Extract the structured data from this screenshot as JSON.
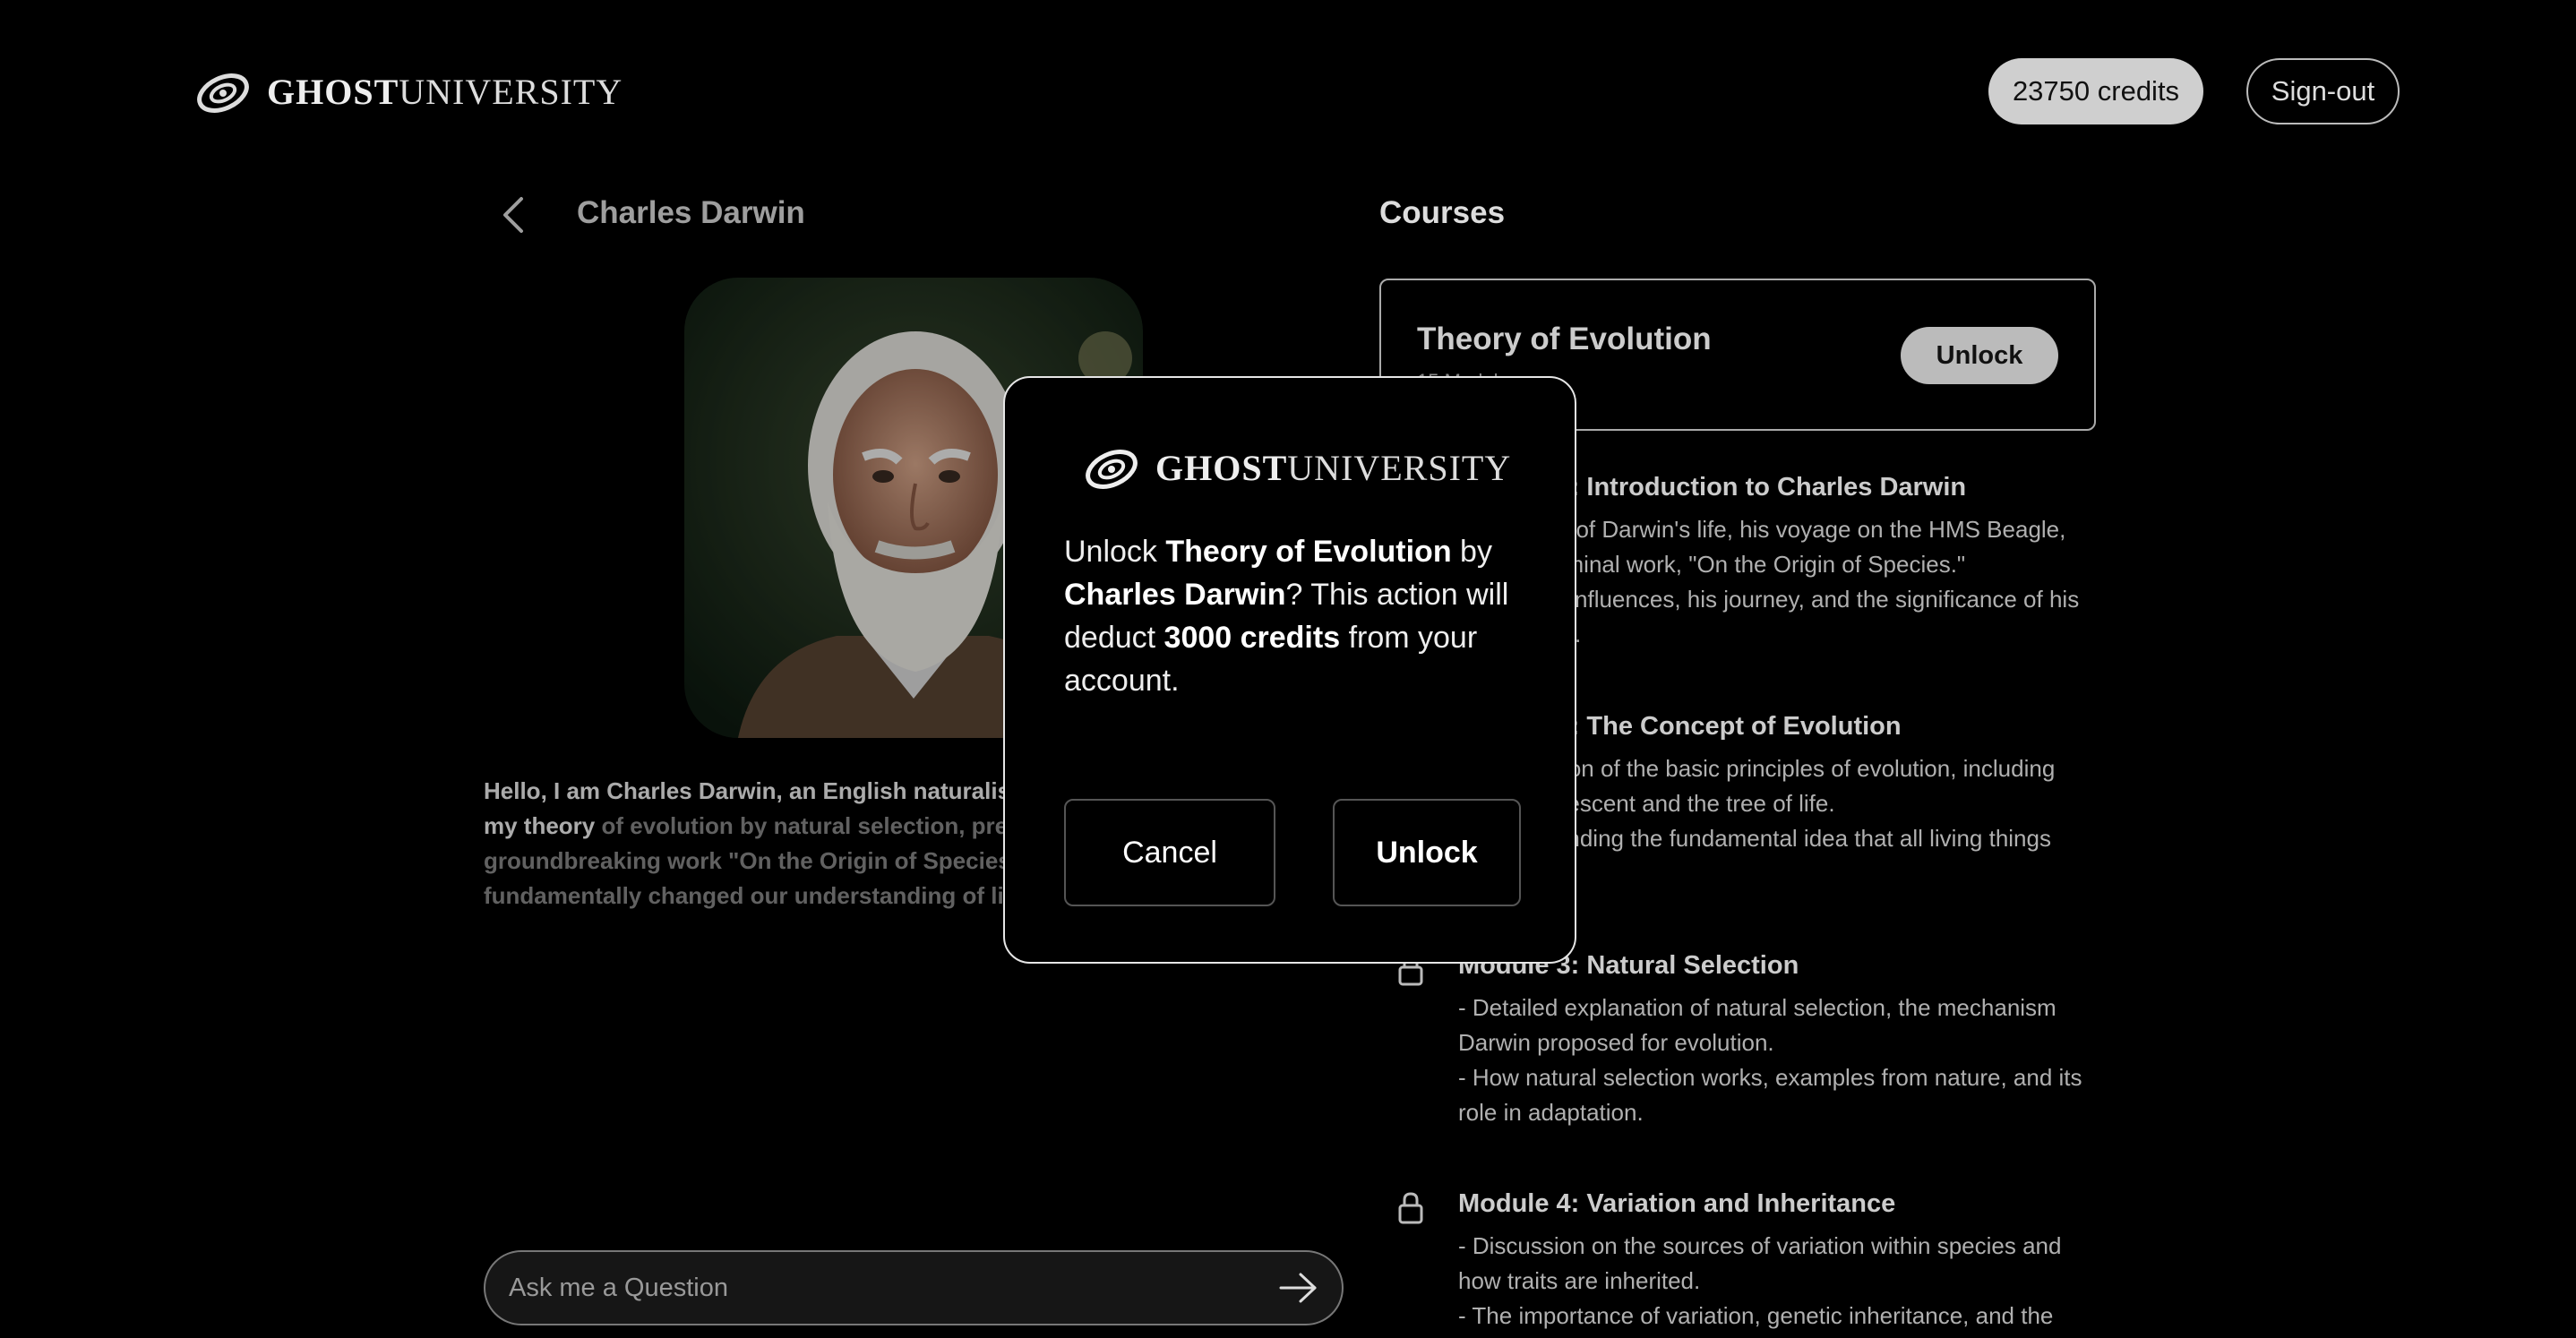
{
  "header": {
    "logo_bold": "GHOST",
    "logo_rest": "UNIVERSITY",
    "credits_label": "23750 credits",
    "signout_label": "Sign-out"
  },
  "profile": {
    "name": "Charles Darwin",
    "bio_bright": "Hello, I am Charles Darwin, an English naturalist. I am best known for my theory",
    "bio_faded": " of evolution by natural selection, presented in my groundbreaking work \"On the Origin of Species.\" My contributions have fundamentally changed our understanding of life on Earth."
  },
  "ask": {
    "placeholder": "Ask me a Question"
  },
  "courses": {
    "title": "Courses",
    "course": {
      "title": "Theory of Evolution",
      "subtitle": "15 Modules",
      "unlock_label": "Unlock"
    },
    "modules": [
      {
        "title": "Module 1: Introduction to Charles Darwin",
        "lines": [
          "- Overview of Darwin's life, his voyage on the HMS Beagle, and his seminal work, \"On the Origin of Species.\"",
          "- His early influences, his journey, and the significance of his discoveries."
        ],
        "icon": "lock-icon"
      },
      {
        "title": "Module 2: The Concept of Evolution",
        "lines": [
          "- Explanation of the basic principles of evolution, including common descent and the tree of life.",
          "- Understanding the fundamental idea that all living things"
        ],
        "icon": "lock-icon"
      },
      {
        "title": "Module 3: Natural Selection",
        "lines": [
          "- Detailed explanation of natural selection, the mechanism Darwin proposed for evolution.",
          "- How natural selection works, examples from nature, and its role in adaptation."
        ],
        "icon": "lock-icon"
      },
      {
        "title": "Module 4: Variation and Inheritance",
        "lines": [
          "- Discussion on the sources of variation within species and how traits are inherited.",
          "- The importance of variation, genetic inheritance, and the"
        ],
        "icon": "lock-icon"
      }
    ]
  },
  "modal": {
    "logo_bold": "GHOST",
    "logo_rest": "UNIVERSITY",
    "msg_1": "Unlock ",
    "msg_course": "Theory of Evolution",
    "msg_2": " by ",
    "msg_author": "Charles Darwin",
    "msg_3": "? This action will deduct ",
    "msg_credits": "3000 credits",
    "msg_4": " from your account.",
    "cancel_label": "Cancel",
    "unlock_label": "Unlock"
  }
}
